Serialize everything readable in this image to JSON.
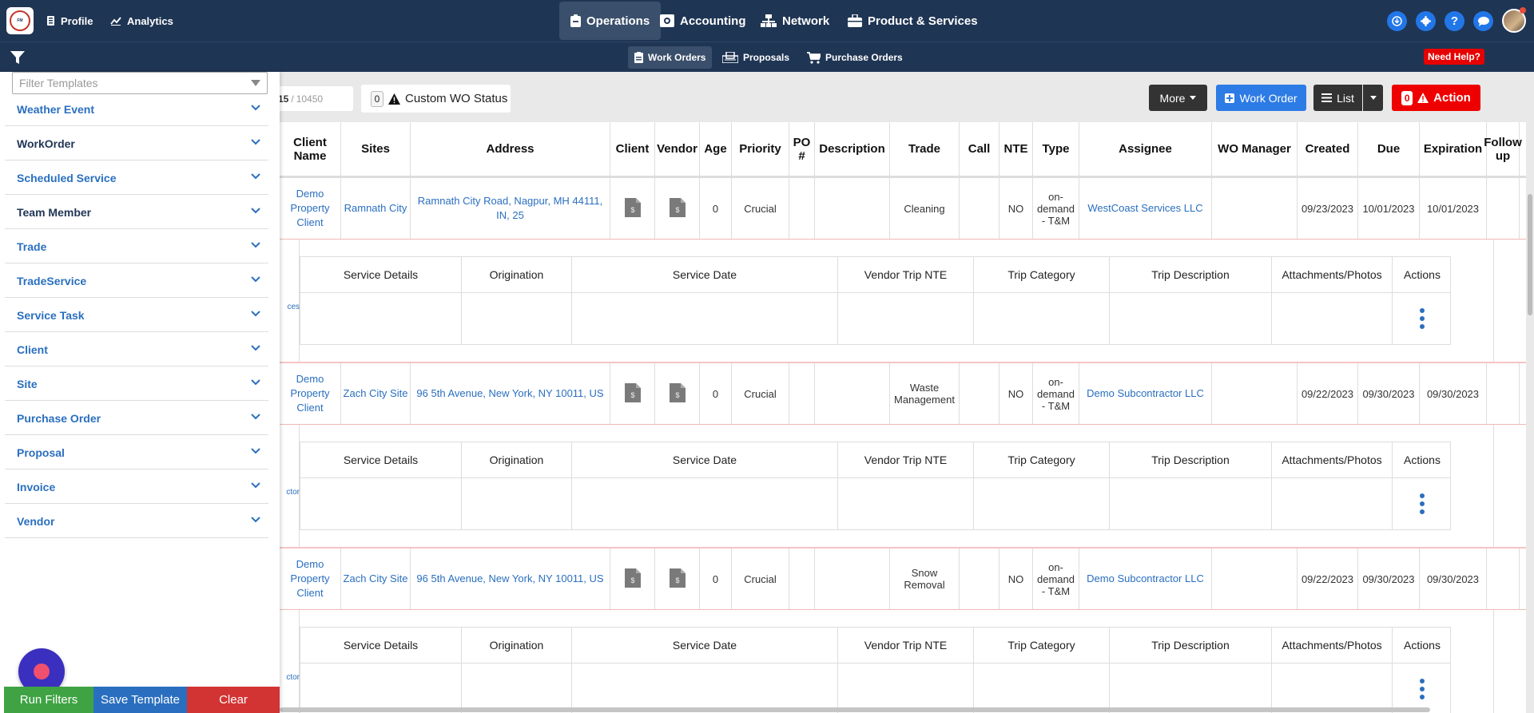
{
  "topnav": {
    "profile": "Profile",
    "analytics": "Analytics",
    "operations": "Operations",
    "accounting": "Accounting",
    "network": "Network",
    "products": "Product & Services"
  },
  "subnav": {
    "work_orders": "Work Orders",
    "proposals": "Proposals",
    "purchase_orders": "Purchase Orders",
    "need_help": "Need Help?"
  },
  "toolbar": {
    "count_current": "15",
    "count_sep": "/",
    "count_total": "10450",
    "custom_wo_count": "0",
    "custom_wo_label": "Custom WO Status",
    "more": "More",
    "work_order": "Work Order",
    "list": "List",
    "action_count": "0",
    "action": "Action"
  },
  "table": {
    "headers": [
      "Client Name",
      "Sites",
      "Address",
      "Client",
      "Vendor",
      "Age",
      "Priority",
      "PO #",
      "Description",
      "Trade",
      "Call",
      "NTE",
      "Type",
      "Assignee",
      "WO Manager",
      "Created",
      "Due",
      "Expiration",
      "Follow up"
    ],
    "rows": [
      {
        "client_name": "Demo Property Client",
        "site": "Ramnath City",
        "address": "Ramnath City Road, Nagpur, MH 44111, IN, 25",
        "age": "0",
        "priority": "Crucial",
        "po": "",
        "description": "",
        "trade": "Cleaning",
        "call": "",
        "nte": "NO",
        "type": "on-demand - T&M",
        "assignee": "WestCoast Services LLC",
        "wo_manager": "",
        "created": "09/23/2023",
        "due": "10/01/2023",
        "expiration": "10/01/2023",
        "sub_cut": "ces"
      },
      {
        "client_name": "Demo Property Client",
        "site": "Zach City Site",
        "address": "96 5th Avenue, New York, NY 10011, US",
        "age": "0",
        "priority": "Crucial",
        "po": "",
        "description": "",
        "trade": "Waste Management",
        "call": "",
        "nte": "NO",
        "type": "on-demand - T&M",
        "assignee": "Demo Subcontractor LLC",
        "wo_manager": "",
        "created": "09/22/2023",
        "due": "09/30/2023",
        "expiration": "09/30/2023",
        "sub_cut": "ctor"
      },
      {
        "client_name": "Demo Property Client",
        "site": "Zach City Site",
        "address": "96 5th Avenue, New York, NY 10011, US",
        "age": "0",
        "priority": "Crucial",
        "po": "",
        "description": "",
        "trade": "Snow Removal",
        "call": "",
        "nte": "NO",
        "type": "on-demand - T&M",
        "assignee": "Demo Subcontractor LLC",
        "wo_manager": "",
        "created": "09/22/2023",
        "due": "09/30/2023",
        "expiration": "09/30/2023",
        "sub_cut": "ctor"
      }
    ],
    "sub_headers": [
      "Service Details",
      "Origination",
      "Service Date",
      "Vendor Trip NTE",
      "Trip Category",
      "Trip Description",
      "Attachments/Photos",
      "Actions"
    ]
  },
  "filter_panel": {
    "template_placeholder": "Filter Templates",
    "items": [
      "Weather Event",
      "WorkOrder",
      "Scheduled Service",
      "Team Member",
      "Trade",
      "TradeService",
      "Service Task",
      "Client",
      "Site",
      "Purchase Order",
      "Proposal",
      "Invoice",
      "Vendor"
    ],
    "run": "Run Filters",
    "save": "Save Template",
    "clear": "Clear"
  }
}
